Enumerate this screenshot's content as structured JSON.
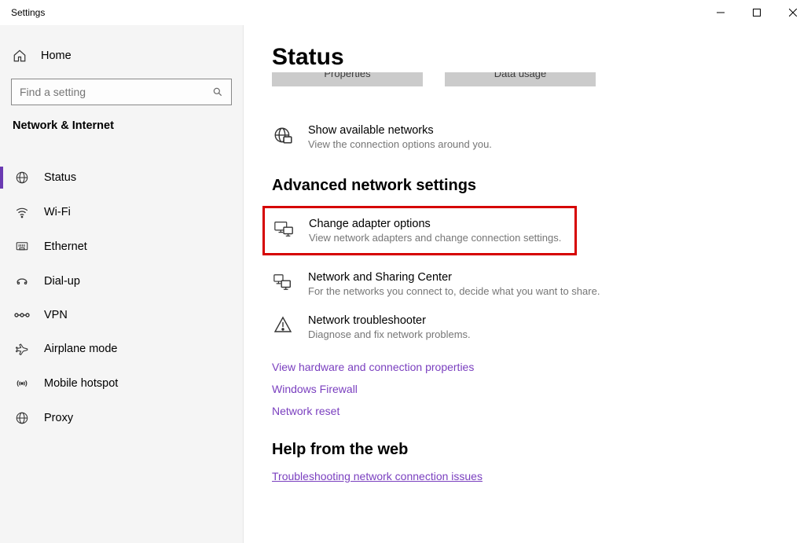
{
  "window": {
    "title": "Settings"
  },
  "sidebar": {
    "home": "Home",
    "search_placeholder": "Find a setting",
    "section": "Network & Internet",
    "items": [
      {
        "label": "Status",
        "selected": true
      },
      {
        "label": "Wi-Fi"
      },
      {
        "label": "Ethernet"
      },
      {
        "label": "Dial-up"
      },
      {
        "label": "VPN"
      },
      {
        "label": "Airplane mode"
      },
      {
        "label": "Mobile hotspot"
      },
      {
        "label": "Proxy"
      }
    ]
  },
  "main": {
    "title": "Status",
    "cut_buttons": [
      "Properties",
      "Data usage"
    ],
    "available": {
      "title": "Show available networks",
      "desc": "View the connection options around you."
    },
    "advanced_header": "Advanced network settings",
    "adapter": {
      "title": "Change adapter options",
      "desc": "View network adapters and change connection settings."
    },
    "sharing": {
      "title": "Network and Sharing Center",
      "desc": "For the networks you connect to, decide what you want to share."
    },
    "troubleshoot": {
      "title": "Network troubleshooter",
      "desc": "Diagnose and fix network problems."
    },
    "links": {
      "hardware": "View hardware and connection properties",
      "firewall": "Windows Firewall",
      "reset": "Network reset"
    },
    "help_header": "Help from the web",
    "help_link": "Troubleshooting network connection issues"
  }
}
